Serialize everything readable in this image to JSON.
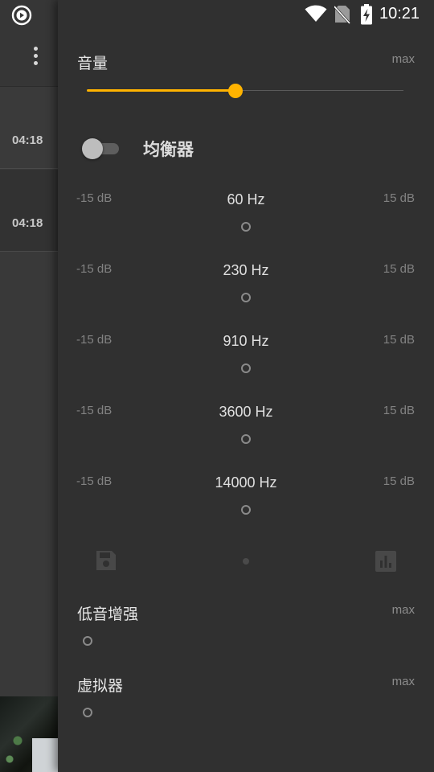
{
  "colors": {
    "accent": "#ffb300",
    "panel_bg": "#303030",
    "list_bg": "#393939"
  },
  "status_bar": {
    "time": "10:21",
    "icons": [
      "wifi-icon",
      "no-sim-icon",
      "battery-charging-icon"
    ]
  },
  "list": {
    "tracks": [
      {
        "duration": "04:18"
      },
      {
        "duration": "04:18"
      }
    ]
  },
  "volume": {
    "label": "音量",
    "max_label": "max",
    "level_fraction": 0.47
  },
  "equalizer": {
    "title": "均衡器",
    "enabled": false,
    "bands": [
      {
        "freq": "60 Hz",
        "min": "-15 dB",
        "max": "15 dB"
      },
      {
        "freq": "230 Hz",
        "min": "-15 dB",
        "max": "15 dB"
      },
      {
        "freq": "910 Hz",
        "min": "-15 dB",
        "max": "15 dB"
      },
      {
        "freq": "3600 Hz",
        "min": "-15 dB",
        "max": "15 dB"
      },
      {
        "freq": "14000 Hz",
        "min": "-15 dB",
        "max": "15 dB"
      }
    ],
    "actions": [
      "save-preset-icon",
      "presets-icon"
    ]
  },
  "bass_boost": {
    "label": "低音增强",
    "max_label": "max"
  },
  "virtualizer": {
    "label": "虚拟器",
    "max_label": "max"
  }
}
